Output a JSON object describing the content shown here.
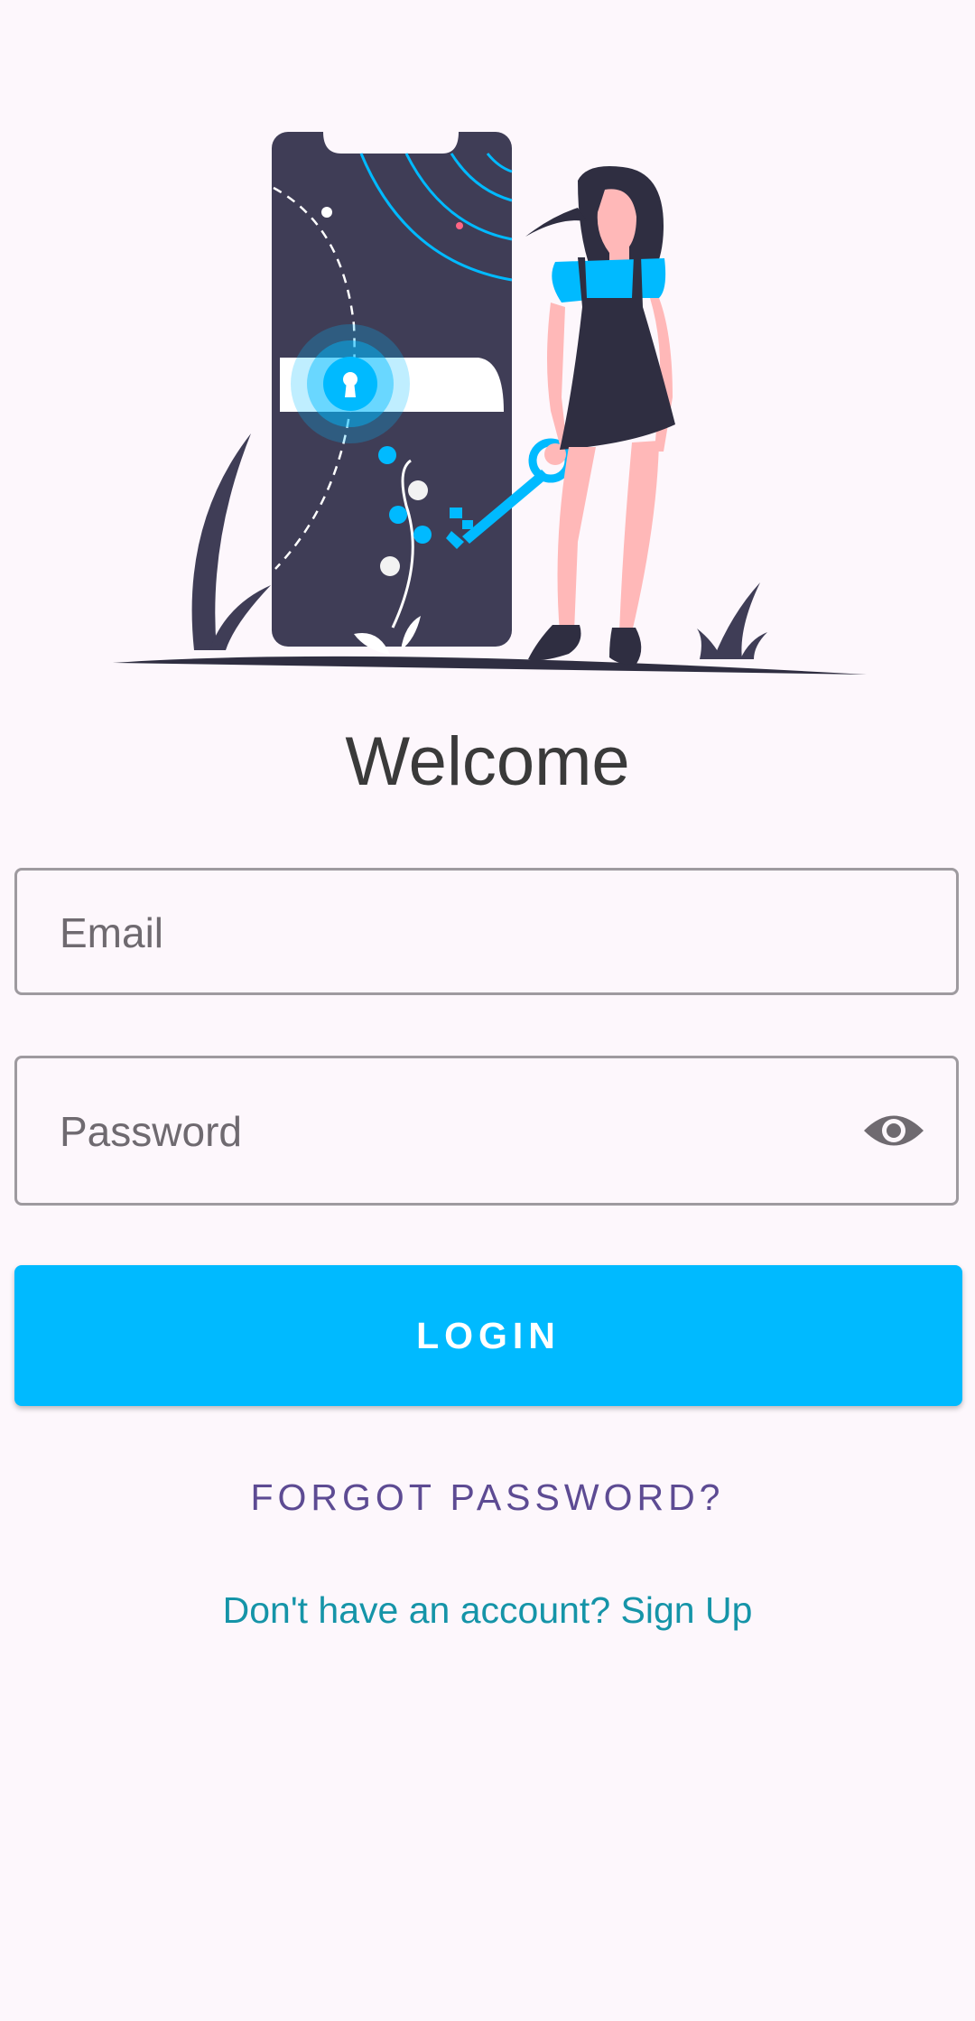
{
  "colors": {
    "background": "#FDF7FC",
    "primary": "#00BAFF",
    "forgot_link": "#5D4B93",
    "signup_link": "#1594A8",
    "phone": "#3F3D56"
  },
  "header": {
    "title": "Welcome"
  },
  "form": {
    "email_placeholder": "Email",
    "email_value": "",
    "password_placeholder": "Password",
    "password_value": "",
    "password_toggle_icon": "eye-icon"
  },
  "actions": {
    "login_label": "LOGIN",
    "forgot_label": "FORGOT PASSWORD?",
    "signup_label": "Don't have an account? Sign Up"
  },
  "illustration": {
    "icon": "phone-lock-illustration"
  }
}
